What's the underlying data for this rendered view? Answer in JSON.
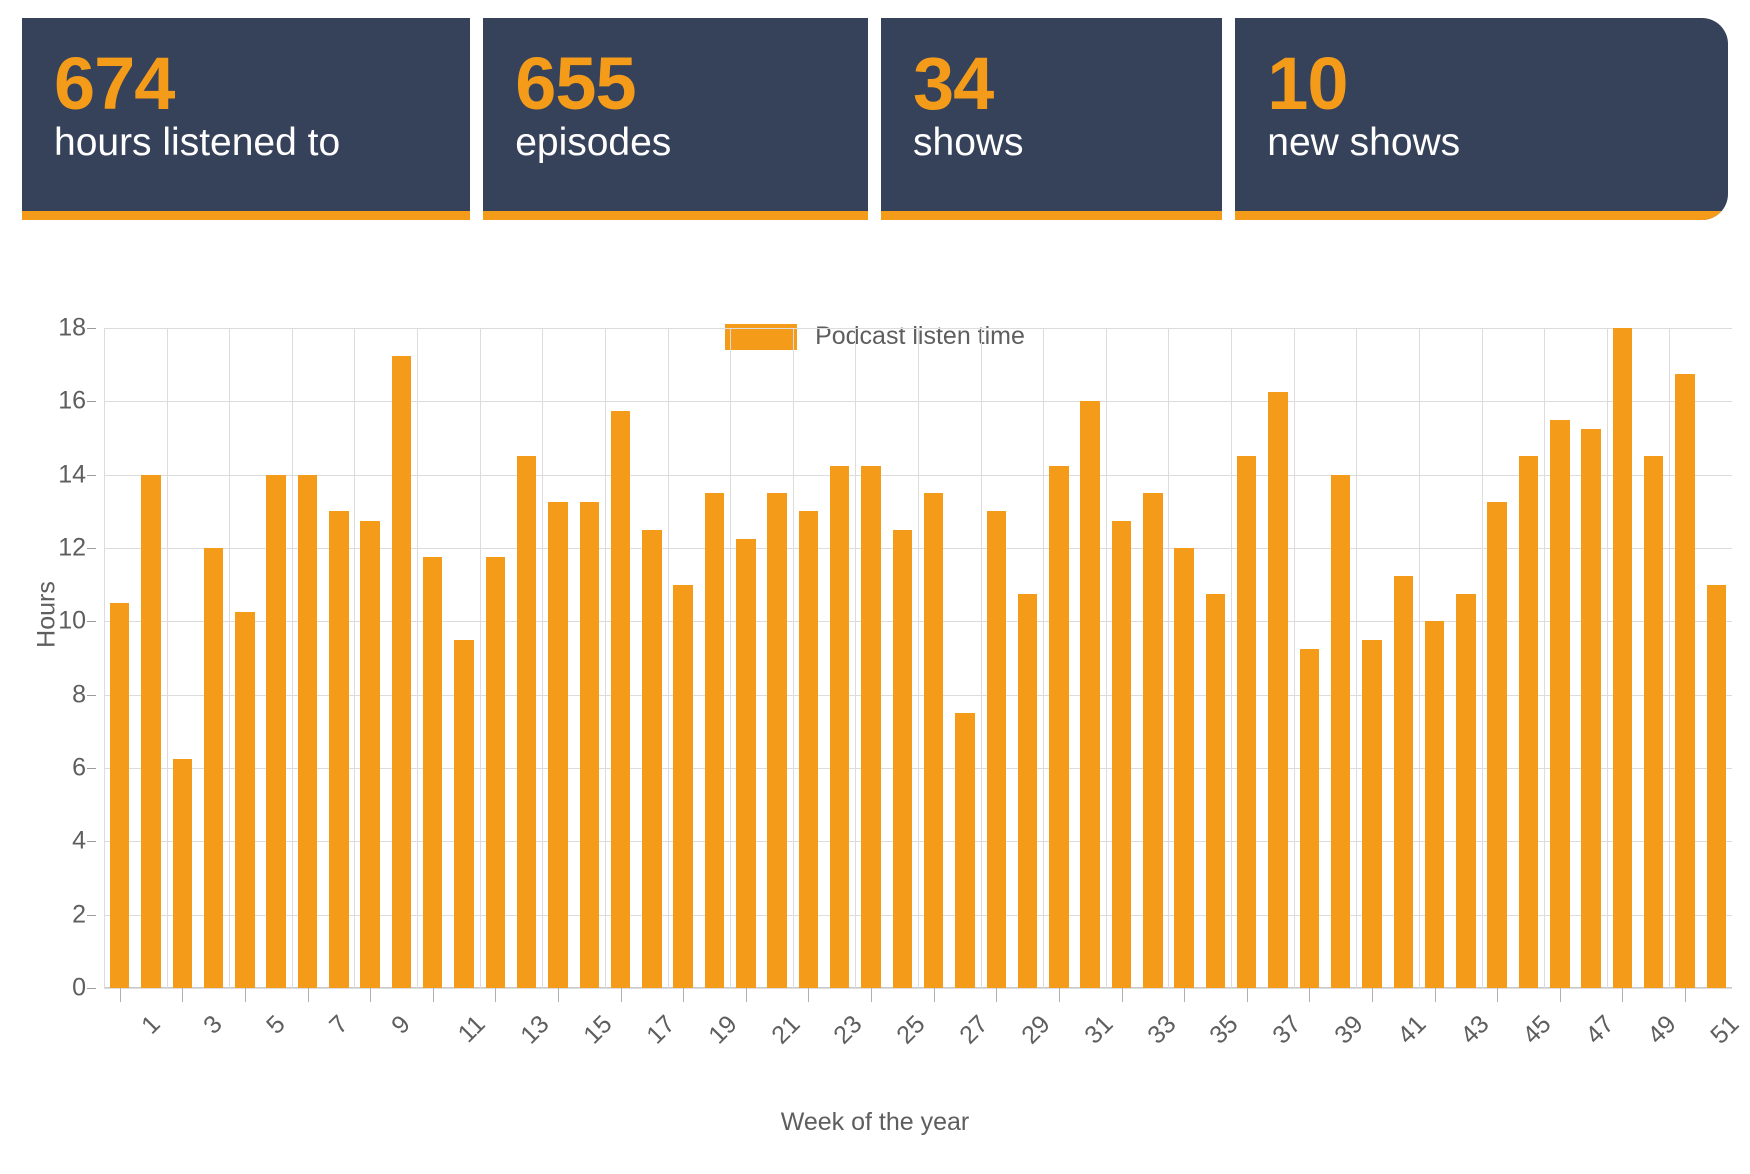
{
  "stat_cards": [
    {
      "value": "674",
      "label": "hours listened to"
    },
    {
      "value": "655",
      "label": "episodes"
    },
    {
      "value": "34",
      "label": "shows"
    },
    {
      "value": "10",
      "label": "new shows"
    }
  ],
  "colors": {
    "card_background": "#36415A",
    "accent_orange": "#F49C19",
    "axis_text": "#5E5E5E",
    "gridline": "#DCDCDC",
    "page_background": "#FFFFFF"
  },
  "chart_data": {
    "type": "bar",
    "title": "",
    "subtitle": "",
    "xlabel": "Week of the year",
    "ylabel": "Hours",
    "ylim": [
      0,
      18
    ],
    "ytick_values": [
      0,
      2,
      4,
      6,
      8,
      10,
      12,
      14,
      16,
      18
    ],
    "ytick_labels": [
      "0",
      "2",
      "4",
      "6",
      "8",
      "10",
      "12",
      "14",
      "16",
      "18"
    ],
    "xtick_labels": [
      "1",
      "3",
      "5",
      "7",
      "9",
      "11",
      "13",
      "15",
      "17",
      "19",
      "21",
      "23",
      "25",
      "27",
      "29",
      "31",
      "33",
      "35",
      "37",
      "39",
      "41",
      "43",
      "45",
      "47",
      "49",
      "51"
    ],
    "xtick_rotation": -45,
    "grid": true,
    "legend": {
      "position": "top-center",
      "entries": [
        "Podcast listen time"
      ]
    },
    "series": [
      {
        "name": "Podcast listen time",
        "color": "#F49C19",
        "values": [
          10.5,
          14.0,
          6.25,
          12.0,
          10.25,
          14.0,
          14.0,
          13.0,
          12.75,
          17.25,
          11.75,
          9.5,
          11.75,
          14.5,
          13.25,
          13.25,
          15.75,
          12.5,
          11.0,
          13.5,
          12.25,
          13.5,
          13.0,
          14.25,
          14.25,
          12.5,
          13.5,
          7.5,
          13.0,
          10.75,
          14.25,
          16.0,
          12.75,
          13.5,
          12.0,
          10.75,
          14.5,
          16.25,
          9.25,
          14.0,
          9.5,
          11.25,
          10.0,
          10.75,
          13.25,
          14.5,
          15.5,
          15.25,
          18.0,
          14.5,
          16.75,
          11.0
        ]
      }
    ],
    "categories": [
      "1",
      "2",
      "3",
      "4",
      "5",
      "6",
      "7",
      "8",
      "9",
      "10",
      "11",
      "12",
      "13",
      "14",
      "15",
      "16",
      "17",
      "18",
      "19",
      "20",
      "21",
      "22",
      "23",
      "24",
      "25",
      "26",
      "27",
      "28",
      "29",
      "30",
      "31",
      "32",
      "33",
      "34",
      "35",
      "36",
      "37",
      "38",
      "39",
      "40",
      "41",
      "42",
      "43",
      "44",
      "45",
      "46",
      "47",
      "48",
      "49",
      "50",
      "51",
      "52"
    ]
  }
}
